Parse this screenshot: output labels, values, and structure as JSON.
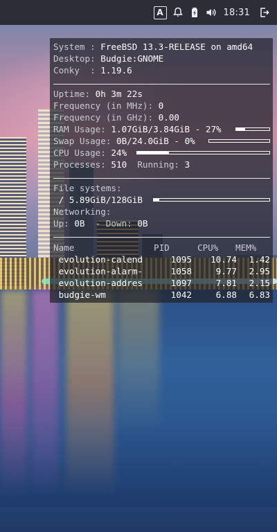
{
  "panel": {
    "keyboard_layout": "A",
    "icons": [
      "notifications-icon",
      "battery-icon",
      "volume-icon",
      "logout-icon"
    ],
    "clock": "18:31"
  },
  "conky": {
    "system_label": "System : ",
    "system_value": "FreeBSD 13.3-RELEASE on amd64",
    "desktop_label": "Desktop: ",
    "desktop_value": "Budgie:GNOME",
    "conky_label": "Conky  : ",
    "conky_value": "1.19.6",
    "uptime_label": "Uptime: ",
    "uptime_value": "0h 3m 22s",
    "freq_mhz_label": "Frequency (in MHz): ",
    "freq_mhz_value": "0",
    "freq_ghz_label": "Frequency (in GHz): ",
    "freq_ghz_value": "0.00",
    "ram_label": "RAM Usage: ",
    "ram_value": "1.07GiB/3.84GiB - 27%",
    "ram_fraction": 0.27,
    "swap_label": "Swap Usage: ",
    "swap_value": "0B/24.0GiB - 0%",
    "swap_fraction": 0.0,
    "cpu_label": "CPU Usage: ",
    "cpu_value": "24%",
    "cpu_fraction": 0.24,
    "processes_label": "Processes: ",
    "processes_value": "510",
    "running_label": "  Running: ",
    "running_value": "3",
    "fs_label": "File systems:",
    "fs_value": " / 5.89GiB/128GiB",
    "fs_fraction": 0.046,
    "net_label": "Networking:",
    "net_up_label": "Up: ",
    "net_up_value": "0B",
    "net_down_label": "  - Down: ",
    "net_down_value": "0B",
    "proc_headers": [
      "Name",
      "PID",
      "CPU%",
      "MEM%"
    ],
    "processes": [
      {
        "name": " evolution-calend",
        "pid": "1095",
        "cpu": "10.74",
        "mem": "1.42"
      },
      {
        "name": " evolution-alarm-",
        "pid": "1058",
        "cpu": "9.77",
        "mem": "2.95"
      },
      {
        "name": " evolution-addres",
        "pid": "1097",
        "cpu": "7.81",
        "mem": "2.15"
      },
      {
        "name": " budgie-wm",
        "pid": "1042",
        "cpu": "6.88",
        "mem": "6.83"
      }
    ]
  }
}
